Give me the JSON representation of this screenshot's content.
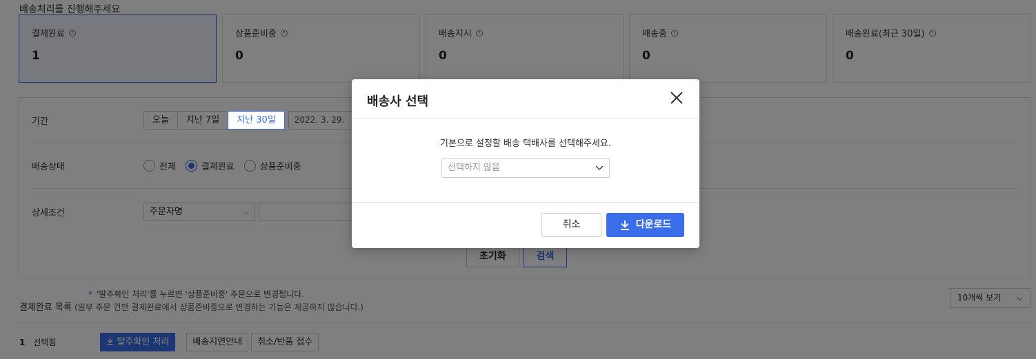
{
  "page": {
    "heading": "배송처리를 진행해주세요"
  },
  "status_cards": [
    {
      "label": "결제완료",
      "count": "1",
      "selected": true
    },
    {
      "label": "상품준비중",
      "count": "0",
      "selected": false
    },
    {
      "label": "배송지시",
      "count": "0",
      "selected": false
    },
    {
      "label": "배송중",
      "count": "0",
      "selected": false
    },
    {
      "label": "배송완료(최근 30일)",
      "count": "0",
      "selected": false
    }
  ],
  "help_glyph": "?",
  "filters": {
    "period": {
      "label": "기간",
      "options": [
        "오늘",
        "지난 7일",
        "지난 30일"
      ],
      "active": "지난 30일",
      "date_from": "2022. 3. 29."
    },
    "delivery_status": {
      "label": "배송상태",
      "options": [
        "전체",
        "결제완료",
        "상품준비중"
      ],
      "selected": "결제완료"
    },
    "detail": {
      "label": "상세조건",
      "field_select": "주문자명",
      "chevron": "⌵"
    },
    "reset_label": "초기화",
    "search_label": "검색"
  },
  "list": {
    "note_star": "*",
    "note": "'발주확인 처리'를 누르면 '상품준비중' 주문으로 변경됩니다.",
    "title": "결제완료 목록",
    "subtitle": "(일부 주문 건만 결제완료에서 상품준비중으로 변경하는 기능은 제공하지 않습니다.)",
    "per_page": "10개씩 보기",
    "selected_count": "1",
    "selected_text": "선택됨",
    "actions": [
      "발주확인 처리",
      "배송지연안내",
      "취소/반품 접수"
    ]
  },
  "modal": {
    "title": "배송사 선택",
    "message": "기본으로 설정할 배송 택배사를 선택해주세요.",
    "courier_placeholder": "선택하지 않음",
    "cancel_label": "취소",
    "download_label": "다운로드"
  },
  "colors": {
    "accent": "#3a6ee8",
    "overlay": "rgba(0,0,0,0.5)"
  }
}
